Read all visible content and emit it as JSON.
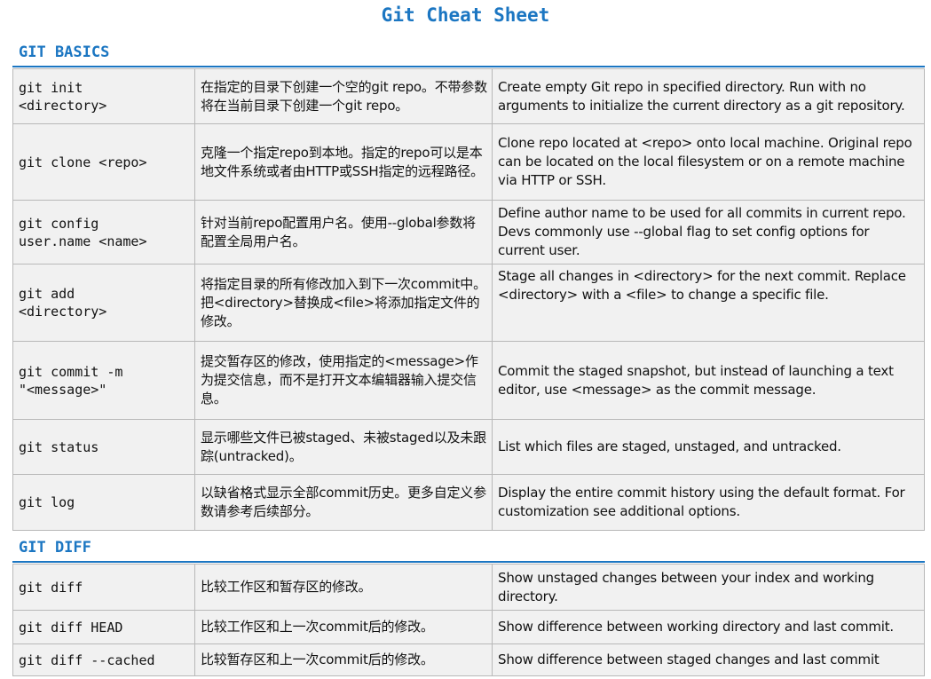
{
  "title": "Git Cheat Sheet",
  "sections": [
    {
      "header": "GIT BASICS",
      "rows": [
        {
          "cmd": "git init\n<directory>",
          "zh": "在指定的目录下创建一个空的git repo。不带参数将在当前目录下创建一个git repo。",
          "en": "Create empty Git repo in specified directory. Run with no arguments to initialize the current directory as a git repository."
        },
        {
          "cmd": "git clone <repo>",
          "zh": "克隆一个指定repo到本地。指定的repo可以是本地文件系统或者由HTTP或SSH指定的远程路径。",
          "en": "Clone repo located at <repo> onto local machine. Original repo can be located on the local filesystem or on a remote machine via HTTP or SSH."
        },
        {
          "cmd": "git config\nuser.name <name>",
          "zh": "针对当前repo配置用户名。使用--global参数将配置全局用户名。",
          "en": "Define author name to be used for all commits in current repo. Devs commonly use --global flag to set config options for current user."
        },
        {
          "cmd": "git add\n<directory>",
          "zh": "将指定目录的所有修改加入到下一次commit中。把<directory>替换成<file>将添加指定文件的修改。",
          "en": "Stage all changes in <directory> for the next commit. Replace <directory> with a <file> to change a specific file."
        },
        {
          "cmd": "git commit -m\n\"<message>\"",
          "zh": "提交暂存区的修改，使用指定的<message>作为提交信息，而不是打开文本编辑器输入提交信息。",
          "en": "Commit the staged snapshot, but instead of launching a text editor, use <message> as the commit message."
        },
        {
          "cmd": "git status",
          "zh": "显示哪些文件已被staged、未被staged以及未跟踪(untracked)。",
          "en": "List which files are staged, unstaged, and untracked."
        },
        {
          "cmd": "git log",
          "zh": "以缺省格式显示全部commit历史。更多自定义参数请参考后续部分。",
          "en": "Display the entire commit history using the default format. For customization see additional options."
        }
      ]
    },
    {
      "header": "GIT DIFF",
      "rows": [
        {
          "cmd": "git diff",
          "zh": "比较工作区和暂存区的修改。",
          "en": "Show unstaged changes between your index and working directory."
        },
        {
          "cmd": "git diff HEAD",
          "zh": "比较工作区和上一次commit后的修改。",
          "en": "Show difference between working directory and last commit."
        },
        {
          "cmd": "git diff --cached",
          "zh": "比较暂存区和上一次commit后的修改。",
          "en": "Show difference between staged changes and last commit"
        }
      ]
    }
  ]
}
